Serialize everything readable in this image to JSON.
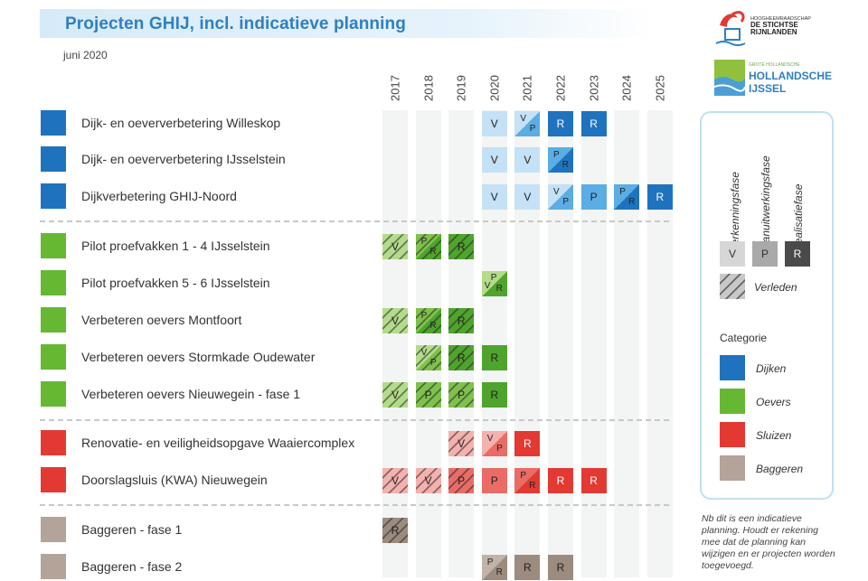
{
  "title": "Projecten GHIJ, incl. indicatieve planning",
  "date": "juni 2020",
  "colors": {
    "dijken": "#1f73be",
    "oevers": "#66b833",
    "sluizen": "#e23a33",
    "baggeren": "#b3a398"
  },
  "logos": {
    "hdsr_line1": "HOOGHEEMRAADSCHAP",
    "hdsr_line2": "DE STICHTSE",
    "hdsr_line3": "RIJNLANDEN",
    "hij_top": "GROTE HOLLANDSCHE",
    "hij_main1": "HOLLANDSCHE",
    "hij_main2": "IJSSEL"
  },
  "chart_data": {
    "type": "table",
    "years": [
      "2017",
      "2018",
      "2019",
      "2020",
      "2021",
      "2022",
      "2023",
      "2024",
      "2025"
    ],
    "projects": [
      {
        "name": "Dijk- en oeververbetering Willeskop",
        "category": "dijken",
        "cells": [
          {
            "year": "2020",
            "phase": "V"
          },
          {
            "year": "2021",
            "phase": "V/P"
          },
          {
            "year": "2022",
            "phase": "R"
          },
          {
            "year": "2023",
            "phase": "R"
          }
        ]
      },
      {
        "name": "Dijk- en oeververbetering IJsselstein",
        "category": "dijken",
        "cells": [
          {
            "year": "2020",
            "phase": "V"
          },
          {
            "year": "2021",
            "phase": "V"
          },
          {
            "year": "2022",
            "phase": "P/R"
          }
        ]
      },
      {
        "name": "Dijkverbetering GHIJ-Noord",
        "category": "dijken",
        "cells": [
          {
            "year": "2020",
            "phase": "V"
          },
          {
            "year": "2021",
            "phase": "V"
          },
          {
            "year": "2022",
            "phase": "V/P"
          },
          {
            "year": "2023",
            "phase": "P"
          },
          {
            "year": "2024",
            "phase": "P/R"
          },
          {
            "year": "2025",
            "phase": "R"
          }
        ]
      },
      {
        "name": "Pilot proefvakken 1 - 4 IJsselstein",
        "category": "oevers",
        "cells": [
          {
            "year": "2017",
            "phase": "V",
            "past": true
          },
          {
            "year": "2018",
            "phase": "P/R",
            "past": true
          },
          {
            "year": "2019",
            "phase": "R",
            "past": true
          }
        ]
      },
      {
        "name": "Pilot proefvakken 5 - 6 IJsselstein",
        "category": "oevers",
        "cells": [
          {
            "year": "2020",
            "phase": "V/P/R"
          }
        ]
      },
      {
        "name": "Verbeteren oevers Montfoort",
        "category": "oevers",
        "cells": [
          {
            "year": "2017",
            "phase": "V",
            "past": true
          },
          {
            "year": "2018",
            "phase": "P/R",
            "past": true
          },
          {
            "year": "2019",
            "phase": "R",
            "past": true
          }
        ]
      },
      {
        "name": "Verbeteren oevers Stormkade Oudewater",
        "category": "oevers",
        "cells": [
          {
            "year": "2018",
            "phase": "V/P",
            "past": true
          },
          {
            "year": "2019",
            "phase": "R",
            "past": true
          },
          {
            "year": "2020",
            "phase": "R"
          }
        ]
      },
      {
        "name": "Verbeteren oevers Nieuwegein - fase 1",
        "category": "oevers",
        "cells": [
          {
            "year": "2017",
            "phase": "V",
            "past": true
          },
          {
            "year": "2018",
            "phase": "P",
            "past": true
          },
          {
            "year": "2019",
            "phase": "P",
            "past": true
          },
          {
            "year": "2020",
            "phase": "R"
          }
        ]
      },
      {
        "name": "Renovatie- en veiligheidsopgave Waaiercomplex",
        "category": "sluizen",
        "cells": [
          {
            "year": "2019",
            "phase": "V",
            "past": true
          },
          {
            "year": "2020",
            "phase": "V/P"
          },
          {
            "year": "2021",
            "phase": "R"
          }
        ]
      },
      {
        "name": "Doorslagsluis (KWA) Nieuwegein",
        "category": "sluizen",
        "cells": [
          {
            "year": "2017",
            "phase": "V",
            "past": true
          },
          {
            "year": "2018",
            "phase": "V",
            "past": true
          },
          {
            "year": "2019",
            "phase": "P",
            "past": true
          },
          {
            "year": "2020",
            "phase": "P"
          },
          {
            "year": "2021",
            "phase": "P/R"
          },
          {
            "year": "2022",
            "phase": "R"
          },
          {
            "year": "2023",
            "phase": "R"
          }
        ]
      },
      {
        "name": "Baggeren - fase 1",
        "category": "baggeren",
        "cells": [
          {
            "year": "2017",
            "phase": "R",
            "past": true
          }
        ]
      },
      {
        "name": "Baggeren - fase 2",
        "category": "baggeren",
        "cells": [
          {
            "year": "2020",
            "phase": "P/R"
          },
          {
            "year": "2021",
            "phase": "R"
          },
          {
            "year": "2022",
            "phase": "R"
          }
        ]
      }
    ]
  },
  "legend": {
    "phases": [
      "Verkenningsfase",
      "Planuitwerkingsfase",
      "Realisatiefase"
    ],
    "phase_letters": [
      "V",
      "P",
      "R"
    ],
    "past_label": "Verleden",
    "category_title": "Categorie",
    "categories": [
      "Dijken",
      "Oevers",
      "Sluizen",
      "Baggeren"
    ]
  },
  "note": "Nb dit is een indicatieve planning. Houdt er rekening mee dat de planning kan wijzigen en er projecten worden toegevoegd."
}
